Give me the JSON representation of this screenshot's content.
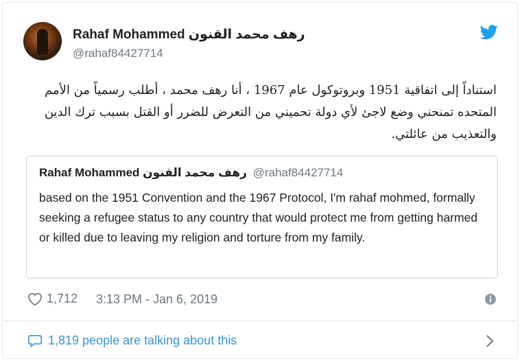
{
  "author": {
    "name": "Rahaf Mohammed رهف محمد القنون",
    "handle": "@rahaf84427714"
  },
  "tweet_text_ar": "استناداً إلى اتفاقية 1951 وبروتوكول عام 1967 ، أنا رهف محمد ، أطلب رسمياً من الأمم المتحده  تمنحني وضع لاجئ لأي دولة تحميني من التعرض للضرر أو القتل بسبب ترك الدين والتعذيب من عائلتي.",
  "quoted_tweet": {
    "name": "Rahaf Mohammed رهف محمد القنون",
    "handle": "@rahaf84427714",
    "text": "based on the 1951 Convention and the 1967 Protocol, I'm rahaf mohmed, formally seeking a refugee status to any country that would protect me from getting harmed or killed due to leaving my religion and torture from my family."
  },
  "likes": "1,712",
  "timestamp": "3:13 PM - Jan 6, 2019",
  "talking": "1,819 people are talking about this",
  "icons": {
    "brand": "twitter-bird-icon",
    "like": "heart-icon",
    "info": "info-icon",
    "reply": "speech-bubble-icon",
    "more": "chevron-right-icon"
  },
  "colors": {
    "twitter_blue": "#1da1f2",
    "link_blue": "#3b94d9",
    "secondary_text": "#697882",
    "border": "#e1e8ed"
  }
}
